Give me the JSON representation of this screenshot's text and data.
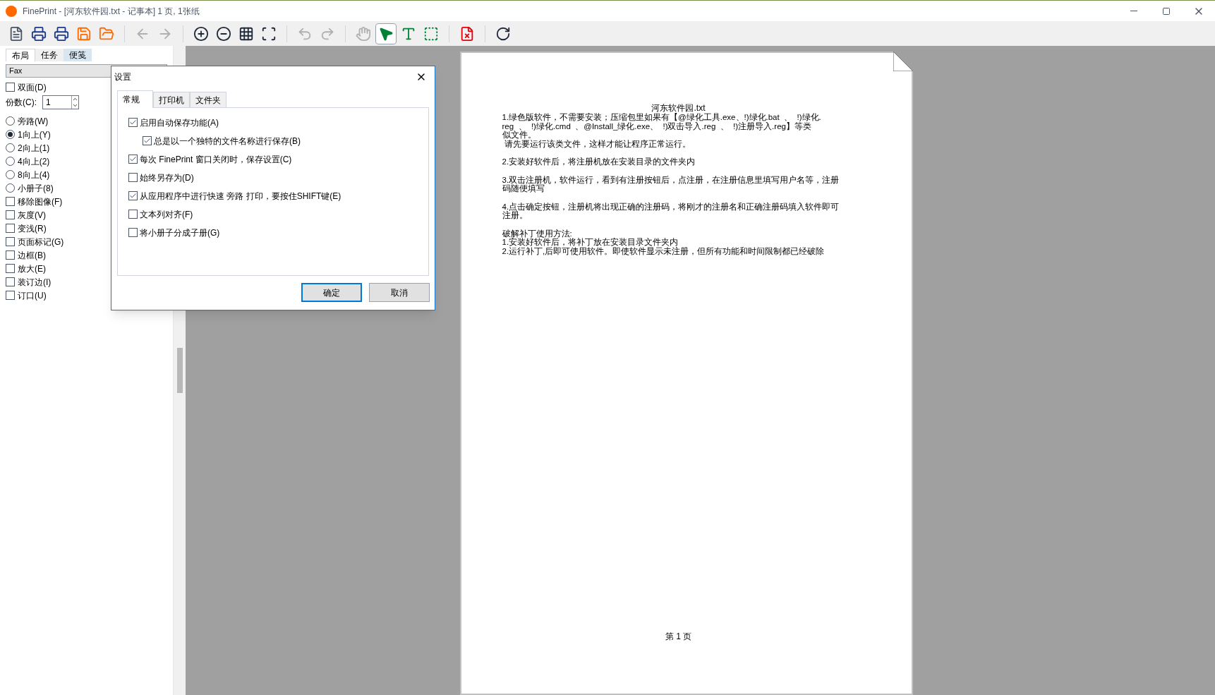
{
  "window": {
    "title": "FinePrint - [河东软件园.txt - 记事本] 1 页, 1张纸"
  },
  "toolbar": [
    {
      "kind": "document",
      "disabled": false,
      "selected": false
    },
    {
      "kind": "print",
      "disabled": false,
      "selected": false
    },
    {
      "kind": "print-delete",
      "disabled": false,
      "selected": false
    },
    {
      "kind": "save",
      "disabled": false,
      "selected": false
    },
    {
      "kind": "open",
      "disabled": false,
      "selected": false
    },
    {
      "kind": "separator"
    },
    {
      "kind": "back",
      "disabled": true,
      "selected": false
    },
    {
      "kind": "forward",
      "disabled": true,
      "selected": false
    },
    {
      "kind": "separator"
    },
    {
      "kind": "zoom-in",
      "disabled": false,
      "selected": false
    },
    {
      "kind": "zoom-out",
      "disabled": false,
      "selected": false
    },
    {
      "kind": "grid",
      "disabled": false,
      "selected": false
    },
    {
      "kind": "fit",
      "disabled": false,
      "selected": false
    },
    {
      "kind": "separator"
    },
    {
      "kind": "undo",
      "disabled": true,
      "selected": false
    },
    {
      "kind": "redo",
      "disabled": true,
      "selected": false
    },
    {
      "kind": "separator"
    },
    {
      "kind": "hand",
      "disabled": true,
      "selected": false
    },
    {
      "kind": "pointer",
      "disabled": false,
      "selected": true
    },
    {
      "kind": "text",
      "disabled": false,
      "selected": false
    },
    {
      "kind": "select",
      "disabled": false,
      "selected": false
    },
    {
      "kind": "separator"
    },
    {
      "kind": "delete-page",
      "disabled": false,
      "selected": false
    },
    {
      "kind": "separator"
    },
    {
      "kind": "refresh",
      "disabled": false,
      "selected": false
    }
  ],
  "sidebar": {
    "tabs": [
      {
        "label": "布局",
        "selected": true
      },
      {
        "label": "任务",
        "selected": false
      },
      {
        "label": "便笺",
        "selected": false
      }
    ],
    "printer": {
      "value": "Fax"
    },
    "copies": {
      "label": "份数(C):",
      "value": "1"
    },
    "items": [
      {
        "kind": "checkbox",
        "label": "双面(D)",
        "checked": false
      },
      {
        "kind": "copies"
      },
      {
        "kind": "radio",
        "label": "旁路(W)",
        "checked": false
      },
      {
        "kind": "radio",
        "label": "1向上(Y)",
        "checked": true
      },
      {
        "kind": "radio",
        "label": "2向上(1)",
        "checked": false
      },
      {
        "kind": "radio",
        "label": "4向上(2)",
        "checked": false
      },
      {
        "kind": "radio",
        "label": "8向上(4)",
        "checked": false
      },
      {
        "kind": "radio",
        "label": "小册子(8)",
        "checked": false
      },
      {
        "kind": "checkbox",
        "label": "移除图像(F)",
        "checked": false
      },
      {
        "kind": "checkbox",
        "label": "灰度(V)",
        "checked": false
      },
      {
        "kind": "checkbox",
        "label": "变浅(R)",
        "checked": false
      },
      {
        "kind": "checkbox",
        "label": "页面标记(G)",
        "checked": false
      },
      {
        "kind": "checkbox",
        "label": "边框(B)",
        "checked": false
      },
      {
        "kind": "checkbox",
        "label": "放大(E)",
        "checked": false
      },
      {
        "kind": "checkbox",
        "label": "装订边(I)",
        "checked": false
      },
      {
        "kind": "checkbox",
        "label": "订口(U)",
        "checked": false
      }
    ]
  },
  "dialog": {
    "title": "设置",
    "tabs": [
      {
        "label": "常规",
        "selected": true
      },
      {
        "label": "打印机",
        "selected": false
      },
      {
        "label": "文件夹",
        "selected": false
      }
    ],
    "options": [
      {
        "label": "启用自动保存功能(A)",
        "checked": true,
        "children": [
          {
            "label": "总是以一个独特的文件名称进行保存(B)",
            "checked": true
          }
        ]
      },
      {
        "label": "每次 FinePrint 窗口关闭时，保存设置(C)",
        "checked": true
      },
      {
        "label": "始终另存为(D)",
        "checked": false
      },
      {
        "label": "从应用程序中进行快速 旁路 打印，要按住SHIFT键(E)",
        "checked": true
      },
      {
        "label": "文本列对齐(F)",
        "checked": false
      },
      {
        "label": "将小册子分成子册(G)",
        "checked": false
      }
    ],
    "buttons": [
      {
        "label": "确定",
        "default": true
      },
      {
        "label": "取消",
        "default": false
      }
    ]
  },
  "document": {
    "title": "河东软件园.txt",
    "paragraphs": [
      [
        "1.绿色版软件，不需要安装；压缩包里如果有【@绿化工具.exe、!)绿化.bat  、  !)绿化.",
        "reg  、  !)绿化.cmd  、@Install_绿化.exe、  !)双击导入.reg  、  !)注册导入.reg】等类",
        "似文件。",
        " 请先要运行该类文件，这样才能让程序正常运行。"
      ],
      [
        "2.安装好软件后，将注册机放在安装目录的文件夹内"
      ],
      [
        "3.双击注册机，软件运行，看到有注册按钮后，点注册，在注册信息里填写用户名等，注册",
        "码随便填写"
      ],
      [
        "4.点击确定按钮，注册机将出现正确的注册码，将刚才的注册名和正确注册码填入软件即可",
        "注册。"
      ],
      [
        "破解补丁使用方法:",
        "1.安装好软件后，将补丁放在安装目录文件夹内",
        "2.运行补丁,后即可使用软件。即使软件显示未注册，但所有功能和时间限制都已经破除"
      ]
    ],
    "footer": "第 1 页"
  }
}
